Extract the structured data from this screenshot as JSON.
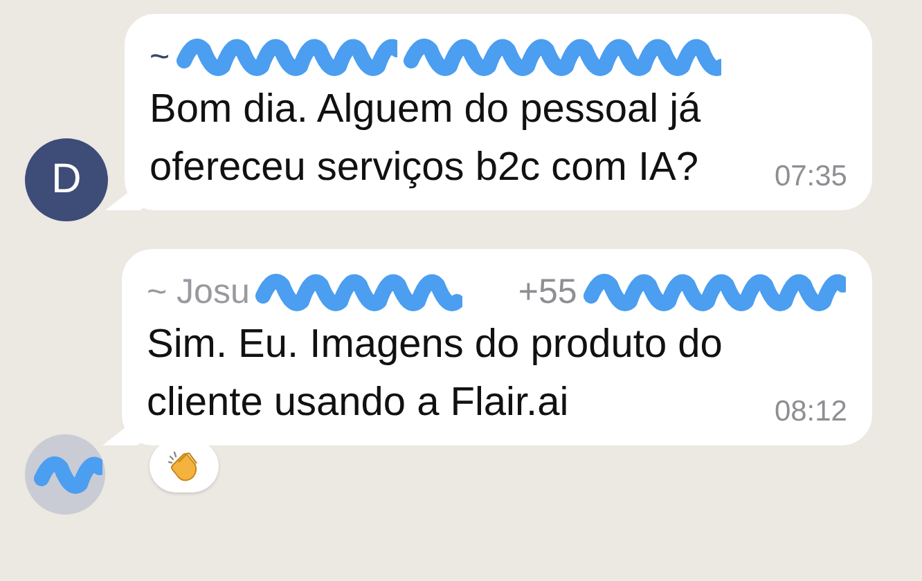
{
  "messages": [
    {
      "sender": {
        "text": "~",
        "color": "#3b4568"
      },
      "avatar": {
        "kind": "initial",
        "letter": "D"
      },
      "text": "Bom dia. Alguem do pessoal já ofereceu serviços b2c com IA?",
      "time": "07:35"
    },
    {
      "sender": {
        "text": "~ Josu",
        "color": "#9a99a0"
      },
      "phone": "+55",
      "avatar": {
        "kind": "photo"
      },
      "text": "Sim. Eu. Imagens do produto do cliente usando a Flair.ai",
      "time": "08:12",
      "reactions": [
        {
          "kind": "clap"
        }
      ]
    }
  ]
}
